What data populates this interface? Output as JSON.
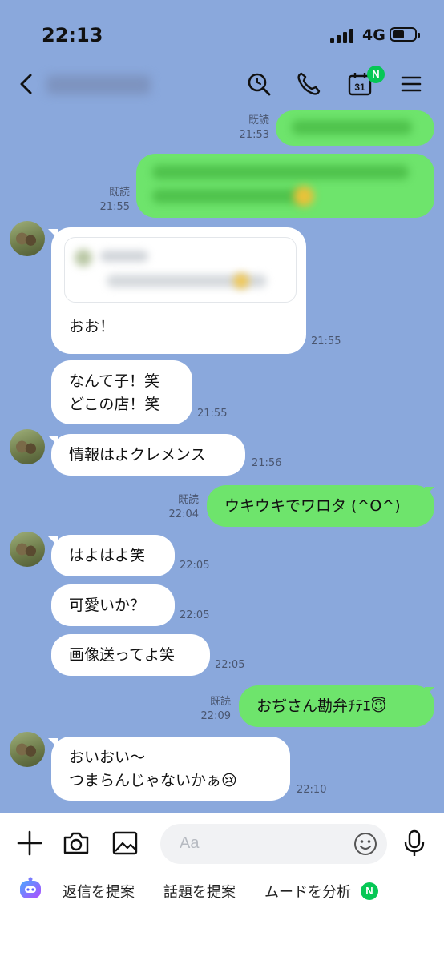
{
  "status": {
    "time": "22:13",
    "network": "4G"
  },
  "header": {
    "calendar_day": "31",
    "calendar_badge": "N"
  },
  "messages": {
    "m1": {
      "read": "既読",
      "time": "21:53"
    },
    "m2": {
      "read": "既読",
      "time": "21:55"
    },
    "m3": {
      "text": "おお！",
      "time": "21:55"
    },
    "m4": {
      "line1": "なんて子！笑",
      "line2": "どこの店！笑",
      "time": "21:55"
    },
    "m5": {
      "text": "情報はよクレメンス",
      "time": "21:56"
    },
    "m6": {
      "read": "既読",
      "text": "ウキウキでワロタ (^O^)",
      "time": "22:04"
    },
    "m7": {
      "text": "はよはよ笑",
      "time": "22:05"
    },
    "m8": {
      "text": "可愛いか？",
      "time": "22:05"
    },
    "m9": {
      "text": "画像送ってよ笑",
      "time": "22:05"
    },
    "m10": {
      "read": "既読",
      "text": "おぢさん勘弁ﾁﾃｴ😇",
      "time": "22:09"
    },
    "m11": {
      "line1": "おいおい〜",
      "line2": "つまらんじゃないかぁ😢",
      "time": "22:10"
    }
  },
  "input": {
    "placeholder": "Aa"
  },
  "suggestions": {
    "reply": "返信を提案",
    "topic": "話題を提案",
    "mood": "ムードを分析",
    "mood_badge": "N"
  },
  "colors": {
    "background": "#8aa8dc",
    "outgoing_bubble": "#6ee46c",
    "incoming_bubble": "#ffffff",
    "badge": "#06c755"
  }
}
